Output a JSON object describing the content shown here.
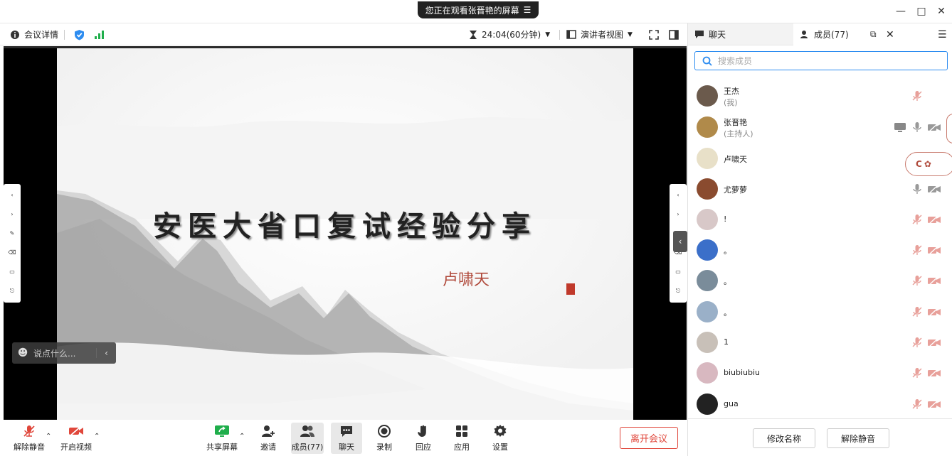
{
  "window": {
    "share_notice": "您正在观看张晋艳的屏幕",
    "minimize": "—",
    "maximize": "□",
    "close": "✕"
  },
  "toolbar": {
    "meeting_info": "会议详情",
    "timer": "24:04(60分钟)",
    "view_mode": "演讲者视图"
  },
  "slide": {
    "title": "安医大省口复试经验分享",
    "author": "卢啸天"
  },
  "side_tools": [
    "<",
    ">",
    "✎",
    "⌫",
    "▭",
    "⎋"
  ],
  "chat_input": {
    "placeholder": "说点什么..."
  },
  "bottom": {
    "unmute": "解除静音",
    "start_video": "开启视频",
    "share_screen": "共享屏幕",
    "invite": "邀请",
    "members": "成员(77)",
    "chat": "聊天",
    "record": "录制",
    "reactions": "回应",
    "apps": "应用",
    "settings": "设置",
    "leave": "离开会议"
  },
  "panel": {
    "tab_chat": "聊天",
    "tab_members": "成员(77)",
    "search_placeholder": "搜索成员",
    "members": [
      {
        "name": "王杰",
        "role": "(我)",
        "mic": "muted",
        "cam": "none",
        "share": false
      },
      {
        "name": "张晋艳",
        "role": "(主持人)",
        "mic": "on",
        "cam": "off",
        "share": true
      },
      {
        "name": "卢啸天",
        "role": "",
        "mic": "none",
        "cam": "none",
        "share": false
      },
      {
        "name": "尤萝萝",
        "role": "",
        "mic": "on",
        "cam": "off",
        "share": false
      },
      {
        "name": "!",
        "role": "",
        "mic": "muted",
        "cam": "off",
        "share": false
      },
      {
        "name": "。",
        "role": "",
        "mic": "muted",
        "cam": "off",
        "share": false
      },
      {
        "name": "。",
        "role": "",
        "mic": "muted",
        "cam": "off",
        "share": false
      },
      {
        "name": "。",
        "role": "",
        "mic": "muted",
        "cam": "off",
        "share": false
      },
      {
        "name": "1",
        "role": "",
        "mic": "muted",
        "cam": "off",
        "share": false
      },
      {
        "name": "biubiubiu",
        "role": "",
        "mic": "muted",
        "cam": "off",
        "share": false
      },
      {
        "name": "gua",
        "role": "",
        "mic": "muted",
        "cam": "off",
        "share": false
      }
    ],
    "rename": "修改名称",
    "unmute": "解除静音"
  },
  "colors": {
    "accent": "#2d8cf0",
    "danger": "#e0473b",
    "mute_red": "#e8a09a",
    "signal_green": "#1fae4b"
  }
}
